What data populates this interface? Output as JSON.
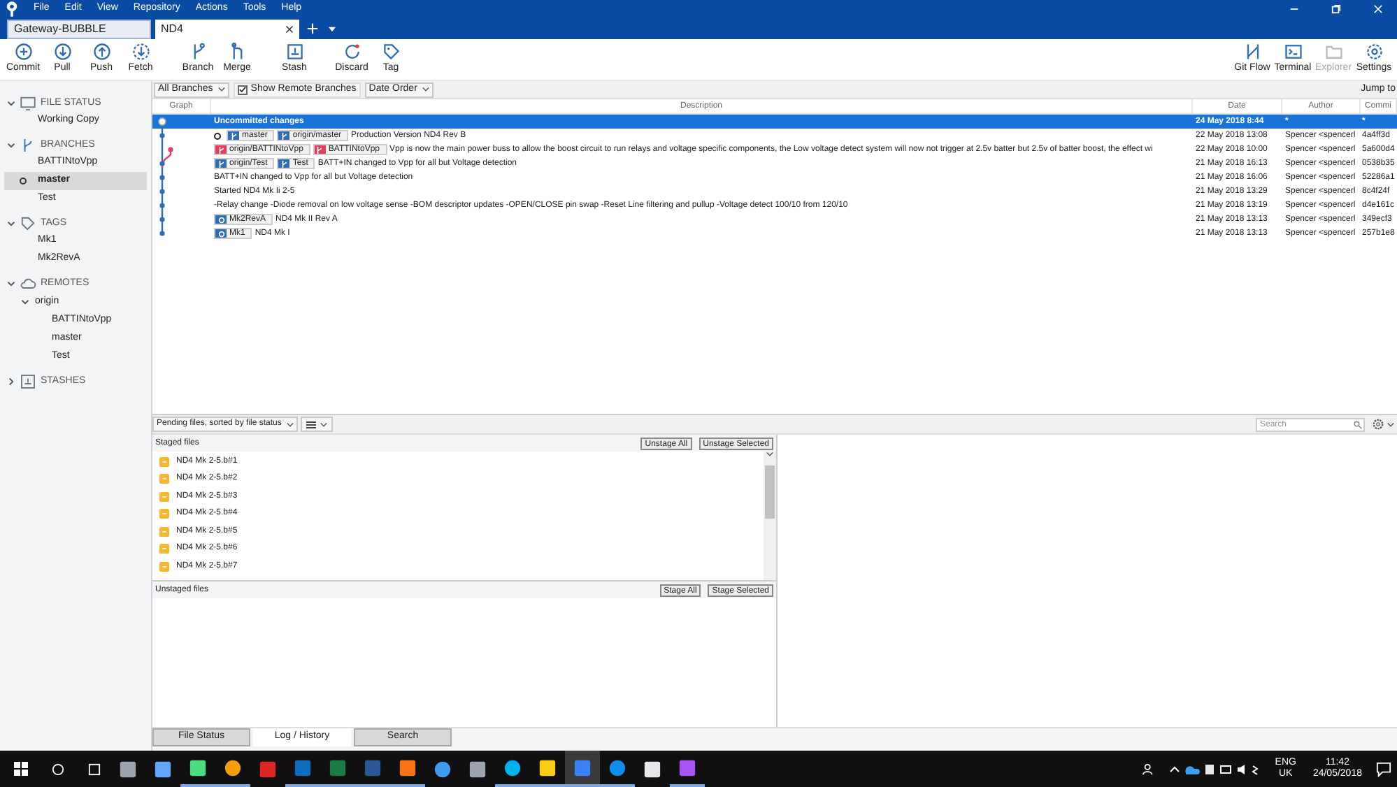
{
  "menu": [
    "File",
    "Edit",
    "View",
    "Repository",
    "Actions",
    "Tools",
    "Help"
  ],
  "repo_tabs": [
    {
      "label": "Gateway-BUBBLE",
      "selected": false
    },
    {
      "label": "ND4",
      "selected": true
    }
  ],
  "toolbar": [
    {
      "label": "Commit",
      "kind": "commit"
    },
    {
      "label": "Pull",
      "kind": "pull"
    },
    {
      "label": "Push",
      "kind": "push"
    },
    {
      "label": "Fetch",
      "kind": "fetch"
    },
    {
      "label": "Branch",
      "kind": "branch"
    },
    {
      "label": "Merge",
      "kind": "merge"
    },
    {
      "label": "Stash",
      "kind": "stash"
    },
    {
      "label": "Discard",
      "kind": "discard"
    },
    {
      "label": "Tag",
      "kind": "tag"
    }
  ],
  "toolbar_right": [
    {
      "label": "Git Flow",
      "kind": "gitflow",
      "disabled": false
    },
    {
      "label": "Terminal",
      "kind": "terminal",
      "disabled": false
    },
    {
      "label": "Explorer",
      "kind": "explorer",
      "disabled": true
    },
    {
      "label": "Settings",
      "kind": "settings",
      "disabled": false
    }
  ],
  "sidebar": [
    {
      "label": "FILE STATUS",
      "kind": "status",
      "expanded": true,
      "children": [
        {
          "label": "Working Copy",
          "selected": false,
          "head": false
        }
      ]
    },
    {
      "label": "BRANCHES",
      "kind": "branch",
      "expanded": true,
      "children": [
        {
          "label": "BATTINtoVpp",
          "selected": false,
          "head": false
        },
        {
          "label": "master",
          "selected": true,
          "head": true
        },
        {
          "label": "Test",
          "selected": false,
          "head": false
        }
      ]
    },
    {
      "label": "TAGS",
      "kind": "tag",
      "expanded": true,
      "children": [
        {
          "label": "Mk1",
          "selected": false,
          "head": false
        },
        {
          "label": "Mk2RevA",
          "selected": false,
          "head": false
        }
      ]
    },
    {
      "label": "REMOTES",
      "kind": "cloud",
      "expanded": true,
      "children": [
        {
          "label": "origin",
          "expanded": true,
          "children": [
            {
              "label": "BATTINtoVpp"
            },
            {
              "label": "master"
            },
            {
              "label": "Test"
            }
          ]
        }
      ]
    },
    {
      "label": "STASHES",
      "kind": "stash",
      "expanded": false
    }
  ],
  "filters": {
    "branches": "All Branches",
    "show_remote": {
      "label": "Show Remote Branches",
      "checked": true
    },
    "order": "Date Order",
    "jump": "Jump to"
  },
  "table": {
    "columns": [
      "Graph",
      "Description",
      "Date",
      "Author",
      "Commi"
    ],
    "rows": [
      {
        "kind": "uncommitted",
        "selected": true,
        "head": false,
        "side_branch": false,
        "refs": [],
        "description": "Uncommitted changes",
        "date": "24 May 2018 8:44",
        "author": "*",
        "commit": "*"
      },
      {
        "kind": "commit",
        "selected": false,
        "head": true,
        "side_branch": false,
        "refs": [
          {
            "label": "master",
            "kind": "branch",
            "color": "#2f6db5"
          },
          {
            "label": "origin/master",
            "kind": "branch",
            "color": "#2f6db5"
          }
        ],
        "description": "Production Version ND4 Rev B",
        "date": "22 May 2018 13:08",
        "author": "Spencer <spencerl",
        "commit": "4a4ff3d"
      },
      {
        "kind": "commit",
        "selected": false,
        "head": false,
        "side_branch": true,
        "refs": [
          {
            "label": "origin/BATTINtoVpp",
            "kind": "branch",
            "color": "#e23d5b"
          },
          {
            "label": "BATTINtoVpp",
            "kind": "branch",
            "color": "#e23d5b"
          }
        ],
        "description": "Vpp is now the main power buss to allow the boost circuit to run relays and voltage specific components, the Low voltage detect system will now not trigger at 2.5v batter but 2.5v of batter boost, the effect wi",
        "date": "22 May 2018 10:00",
        "author": "Spencer <spencerl",
        "commit": "5a600d4"
      },
      {
        "kind": "commit",
        "selected": false,
        "head": false,
        "side_branch": false,
        "refs": [
          {
            "label": "origin/Test",
            "kind": "branch",
            "color": "#2f6db5"
          },
          {
            "label": "Test",
            "kind": "branch",
            "color": "#2f6db5"
          }
        ],
        "description": "BATT+IN changed to Vpp for all but Voltage detection",
        "date": "21 May 2018 16:13",
        "author": "Spencer <spencerl",
        "commit": "0538b35"
      },
      {
        "kind": "commit",
        "selected": false,
        "head": false,
        "side_branch": false,
        "refs": [],
        "description": "BATT+IN changed to Vpp for all but Voltage detection",
        "date": "21 May 2018 16:06",
        "author": "Spencer <spencerl",
        "commit": "52286a1"
      },
      {
        "kind": "commit",
        "selected": false,
        "head": false,
        "side_branch": false,
        "refs": [],
        "description": "Started ND4 Mk Ii 2-5",
        "date": "21 May 2018 13:29",
        "author": "Spencer <spencerl",
        "commit": "8c4f24f"
      },
      {
        "kind": "commit",
        "selected": false,
        "head": false,
        "side_branch": false,
        "refs": [],
        "description": "-Relay change -Diode removal on low voltage sense -BOM descriptor updates -OPEN/CLOSE pin swap -Reset Line filtering and pullup -Voltage detect 100/10 from 120/10",
        "date": "21 May 2018 13:19",
        "author": "Spencer <spencerl",
        "commit": "d4e161c"
      },
      {
        "kind": "commit",
        "selected": false,
        "head": false,
        "side_branch": false,
        "refs": [
          {
            "label": "Mk2RevA",
            "kind": "tag",
            "color": "#2f6db5"
          }
        ],
        "description": "ND4 Mk II Rev A",
        "date": "21 May 2018 13:13",
        "author": "Spencer <spencerl",
        "commit": "349ecf3"
      },
      {
        "kind": "commit",
        "selected": false,
        "head": false,
        "side_branch": false,
        "refs": [
          {
            "label": "Mk1",
            "kind": "tag",
            "color": "#2f6db5"
          }
        ],
        "description": "ND4 Mk I",
        "date": "21 May 2018 13:13",
        "author": "Spencer <spencerl",
        "commit": "257b1e8"
      }
    ]
  },
  "pending": {
    "sort": "Pending files, sorted by file status",
    "search": {
      "placeholder": "Search"
    },
    "staged": {
      "title": "Staged files",
      "buttons": [
        "Unstage All",
        "Unstage Selected"
      ],
      "files": [
        "ND4 Mk 2-5.b#1",
        "ND4 Mk 2-5.b#2",
        "ND4 Mk 2-5.b#3",
        "ND4 Mk 2-5.b#4",
        "ND4 Mk 2-5.b#5",
        "ND4 Mk 2-5.b#6",
        "ND4 Mk 2-5.b#7"
      ]
    },
    "unstaged": {
      "title": "Unstaged files",
      "buttons": [
        "Stage All",
        "Stage Selected"
      ]
    }
  },
  "bottom_tabs": [
    {
      "label": "File Status",
      "selected": false
    },
    {
      "label": "Log / History",
      "selected": true
    },
    {
      "label": "Search",
      "selected": false
    }
  ],
  "taskbar": {
    "apps": [
      {
        "kind": "calc",
        "active": false
      },
      {
        "kind": "paint",
        "active": false
      },
      {
        "kind": "image",
        "active": true
      },
      {
        "kind": "chrome",
        "active": true
      },
      {
        "kind": "red",
        "active": false
      },
      {
        "kind": "outlook",
        "active": true
      },
      {
        "kind": "excel",
        "active": true
      },
      {
        "kind": "word",
        "active": true
      },
      {
        "kind": "e",
        "active": true
      },
      {
        "kind": "edge",
        "active": false
      },
      {
        "kind": "printer",
        "active": false
      },
      {
        "kind": "skype",
        "active": true
      },
      {
        "kind": "folder",
        "active": true
      },
      {
        "kind": "sourcetree",
        "active": true
      },
      {
        "kind": "teamviewer",
        "active": true
      },
      {
        "kind": "store",
        "active": false
      },
      {
        "kind": "archive",
        "active": true
      }
    ],
    "lang": "ENG",
    "region": "UK",
    "time": "11:42",
    "date": "24/05/2018"
  }
}
